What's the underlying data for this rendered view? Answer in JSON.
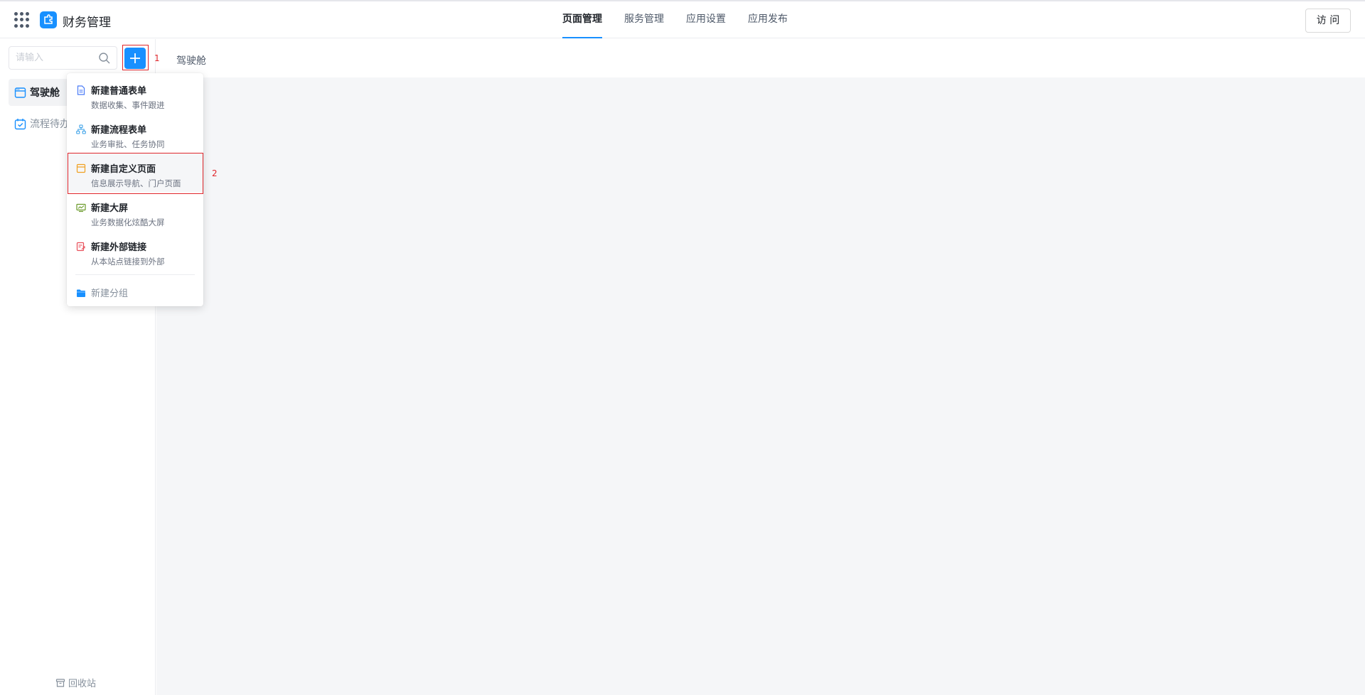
{
  "header": {
    "app_name": "财务管理",
    "tabs": [
      {
        "label": "页面管理",
        "active": true
      },
      {
        "label": "服务管理",
        "active": false
      },
      {
        "label": "应用设置",
        "active": false
      },
      {
        "label": "应用发布",
        "active": false
      }
    ],
    "visit_label": "访 问",
    "accent_color": "#1890ff"
  },
  "sidebar": {
    "search_placeholder": "请输入",
    "items": [
      {
        "label": "驾驶舱",
        "icon": "dashboard-icon",
        "active": true
      },
      {
        "label": "流程待办",
        "icon": "calendar-check-icon",
        "active": false
      }
    ],
    "recycle_label": "回收站"
  },
  "breadcrumb": "驾驶舱",
  "dropdown": {
    "items": [
      {
        "title": "新建普通表单",
        "desc": "数据收集、事件跟进",
        "icon": "form-icon"
      },
      {
        "title": "新建流程表单",
        "desc": "业务审批、任务协同",
        "icon": "flow-icon"
      },
      {
        "title": "新建自定义页面",
        "desc": "信息展示导航、门户页面",
        "icon": "custom-page-icon"
      },
      {
        "title": "新建大屏",
        "desc": "业务数据化炫酷大屏",
        "icon": "big-screen-icon"
      },
      {
        "title": "新建外部链接",
        "desc": "从本站点链接到外部",
        "icon": "external-link-icon"
      }
    ],
    "group_label": "新建分组"
  },
  "annotations": {
    "label_1": "1",
    "label_2": "2",
    "color": "#e0262b"
  }
}
